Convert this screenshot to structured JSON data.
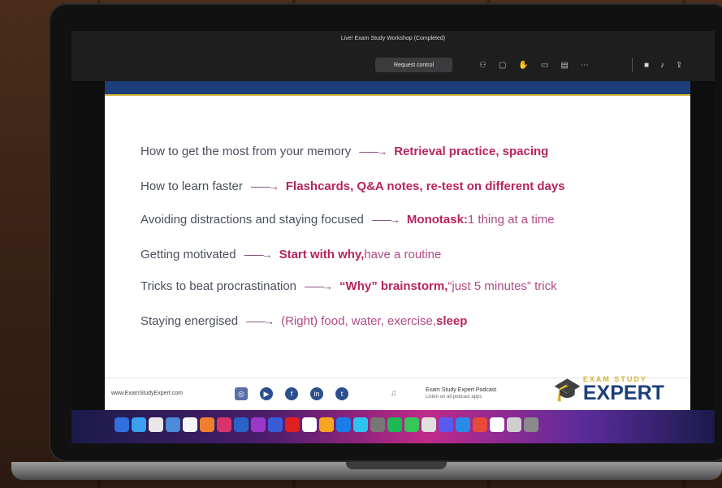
{
  "meeting": {
    "title": "Live! Exam Study Workshop (Completed)",
    "request_control": "Request control",
    "toolbar_icons": [
      "people-icon",
      "chat-icon",
      "raise-hand-icon",
      "view-icon",
      "more-options-icon",
      "camera-icon",
      "mic-icon",
      "share-icon"
    ]
  },
  "slide": {
    "rows": [
      {
        "topic": "How to get the most from your memory",
        "strong": "Retrieval practice, spacing",
        "soft": ""
      },
      {
        "topic": "How to learn faster",
        "strong": "Flashcards, Q&A notes, re-test on different days",
        "soft": ""
      },
      {
        "topic": "Avoiding distractions and staying focused",
        "strong": "Monotask:",
        "soft": " 1 thing at a time"
      },
      {
        "topic": "Getting motivated",
        "strong": "Start with why,",
        "soft": " have a routine"
      },
      {
        "topic": "Tricks to beat procrastination",
        "strong": "“Why” brainstorm,",
        "soft": " “just 5 minutes” trick"
      },
      {
        "topic": "Staying energised",
        "soft_pre": "(Right) food, water, exercise, ",
        "strong": "sleep",
        "soft": ""
      }
    ],
    "footer": {
      "site": "www.ExamStudyExpert.com",
      "podcast_title": "Exam Study Expert Podcast",
      "podcast_sub": "Listen on all podcast apps",
      "logo_top": "EXAM STUDY",
      "logo_main": "EXPERT"
    }
  },
  "colors": {
    "band": "#1c3f7a",
    "accent": "#d9b23a",
    "highlight": "#b8235e"
  }
}
